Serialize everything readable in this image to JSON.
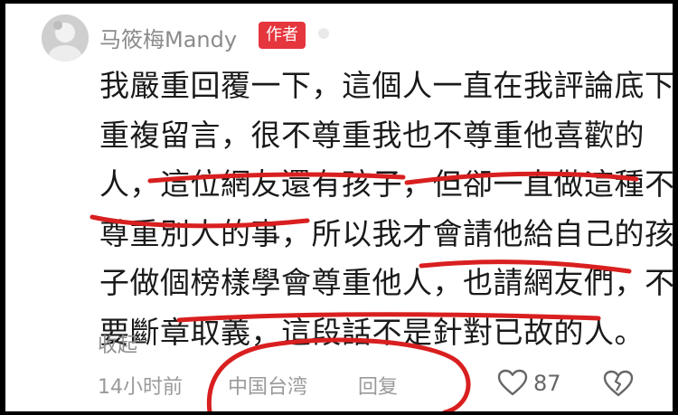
{
  "comment": {
    "author": "马筱梅Mandy",
    "author_badge": "作者",
    "lines": [
      "我嚴重回覆一下，這個人一直在我評論底下",
      "重複留言，很不尊重我也不尊重他喜歡的",
      "人，這位網友還有孩子，但卻一直做這種不",
      "尊重別人的事，所以我才會請他給自己的孩",
      "子做個榜樣學會尊重他人，也請網友們，不",
      "要斷章取義，這段話不是針對已故的人。"
    ],
    "collapse_label": "收起",
    "time": "14小时前",
    "location": "中国台湾",
    "reply_label": "回复",
    "like_count": "87"
  },
  "colors": {
    "badge": "#e5353d",
    "annotation": "#d91f1f",
    "meta_text": "#9a9a9a",
    "body_text": "#1a1a1a"
  },
  "icons": {
    "like": "heart-outline-icon",
    "dislike": "broken-heart-icon",
    "avatar": "avatar-image"
  }
}
